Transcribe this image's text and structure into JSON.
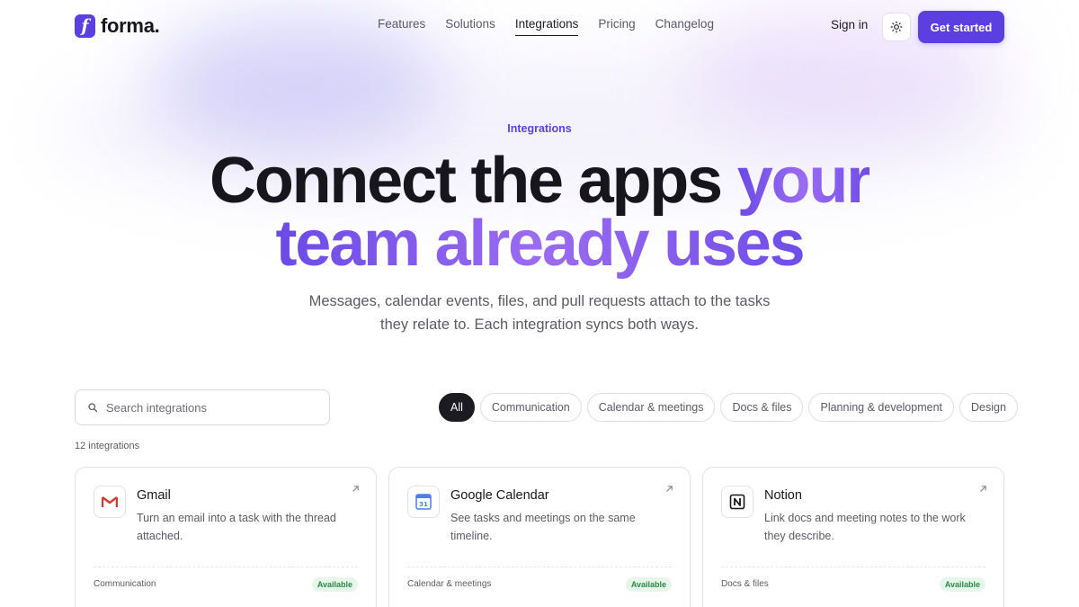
{
  "brand": {
    "name": "forma.",
    "mark": "f",
    "accent": "#5b3fe0"
  },
  "nav": {
    "links": [
      {
        "label": "Features",
        "active": false
      },
      {
        "label": "Solutions",
        "active": false
      },
      {
        "label": "Integrations",
        "active": true
      },
      {
        "label": "Pricing",
        "active": false
      },
      {
        "label": "Changelog",
        "active": false
      }
    ],
    "signin": "Sign in",
    "theme_icon": "sun-icon",
    "cta": "Get started"
  },
  "hero": {
    "eyebrow": "Integrations",
    "headline_part1": "Connect the apps ",
    "headline_part2": "your",
    "headline_part3": "team already uses",
    "subtitle_line1": "Messages, calendar events, files, and pull requests attach to the tasks",
    "subtitle_line2": "they relate to. Each integration syncs both ways."
  },
  "search": {
    "placeholder": "Search integrations",
    "value": ""
  },
  "filters": [
    {
      "label": "All",
      "active": true
    },
    {
      "label": "Communication",
      "active": false
    },
    {
      "label": "Calendar & meetings",
      "active": false
    },
    {
      "label": "Docs & files",
      "active": false
    },
    {
      "label": "Planning & development",
      "active": false
    },
    {
      "label": "Design",
      "active": false
    }
  ],
  "count_label": "12 integrations",
  "integrations": [
    {
      "name": "Gmail",
      "icon": "gmail-icon",
      "description": "Turn an email into a task with the thread attached.",
      "category": "Communication",
      "status": "Available"
    },
    {
      "name": "Google Calendar",
      "icon": "google-calendar-icon",
      "description": "See tasks and meetings on the same timeline.",
      "category": "Calendar & meetings",
      "status": "Available"
    },
    {
      "name": "Notion",
      "icon": "notion-icon",
      "description": "Link docs and meeting notes to the work they describe.",
      "category": "Docs & files",
      "status": "Available"
    }
  ],
  "colors": {
    "status_available_bg": "#e6f6ea",
    "status_available_text": "#2a8a44"
  }
}
